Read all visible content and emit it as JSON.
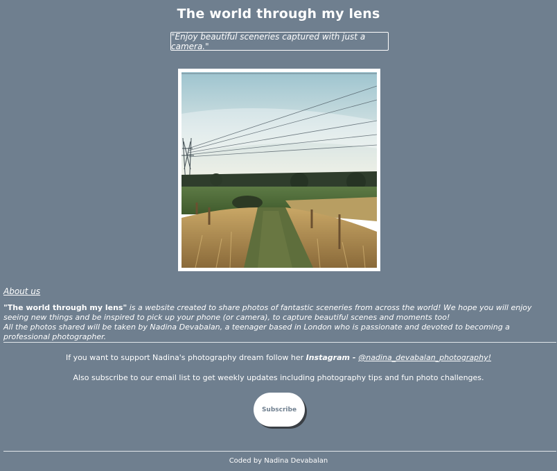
{
  "header": {
    "title": "The world through my lens",
    "tagline": "\"Enjoy beautiful sceneries captured with just a camera.\""
  },
  "about": {
    "heading": "About us",
    "site_name": "\"The world through my lens\"",
    "line1": " is a website created to share photos of fantastic sceneries from across the world! We hope you will enjoy seeing new things and be inspired to pick up your phone (or camera), to capture beautiful scenes and moments too!",
    "line2": "All the photos shared will be taken by Nadina Devabalan, a teenager based in London who is passionate and devoted to becoming a professional photographer."
  },
  "support": {
    "text": "If you want to support Nadina's photography dream follow her ",
    "instagram_label": "Instagram - ",
    "instagram_handle": "@nadina_devabalan_photography!",
    "subscribe_text": "Also subscribe to our email list to get weekly updates including photography tips and fun photo challenges.",
    "subscribe_button": "Subscribe"
  },
  "footer": {
    "credit": "Coded by Nadina Devabalan"
  },
  "colors": {
    "background": "#6f7f8f",
    "text": "#ffffff"
  }
}
